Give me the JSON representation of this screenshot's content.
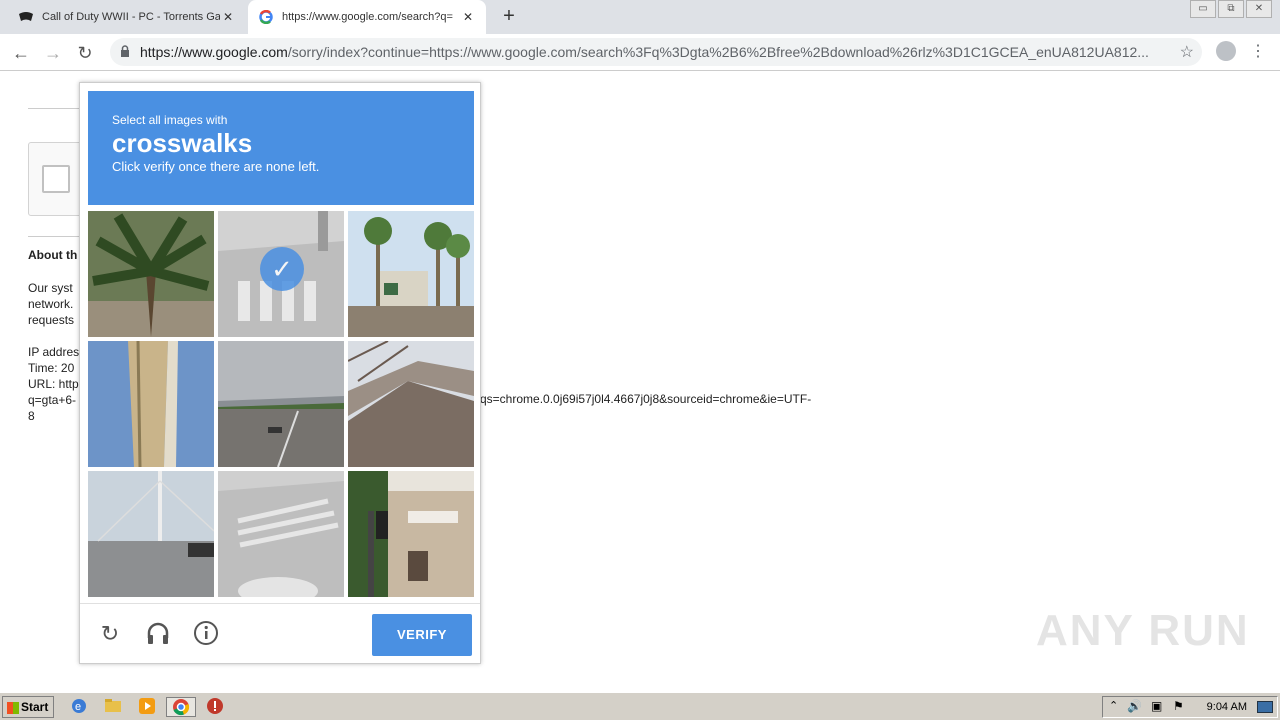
{
  "browser": {
    "tabs": [
      {
        "title": "Call of Duty WWII - PC - Torrents Ga",
        "close": "✕"
      },
      {
        "title": "https://www.google.com/search?q=",
        "close": "✕"
      }
    ],
    "new_tab": "+",
    "window_controls": [
      "▭",
      "⧉",
      "✕"
    ],
    "url_host": "https://www.google.com",
    "url_rest": "/sorry/index?continue=https://www.google.com/search%3Fq%3Dgta%2B6%2Bfree%2Bdownload%26rlz%3D1C1GCEA_enUA812UA812...",
    "nav": {
      "back": "←",
      "forward": "→",
      "reload": "↻"
    },
    "star": "☆",
    "menu": "⋮"
  },
  "page": {
    "about": "About th",
    "para": [
      "Our syst",
      "network.",
      "requests"
    ],
    "ip_lines": [
      "IP addres",
      "Time: 20",
      "URL: http",
      "q=gta+6-",
      "8"
    ],
    "url_tail": "qs=chrome.0.0j69i57j0l4.4667j0j8&sourceid=chrome&ie=UTF-"
  },
  "captcha": {
    "small": "Select all images with",
    "big": "crosswalks",
    "sub": "Click verify once there are none left.",
    "verify": "VERIFY",
    "icons": [
      "reload-icon",
      "headphones-icon",
      "info-icon"
    ],
    "selected_tile": 2
  },
  "watermark": "ANY RUN",
  "taskbar": {
    "start": "Start",
    "clock": "9:04 AM"
  },
  "colors": {
    "accent": "#4a90e2"
  }
}
